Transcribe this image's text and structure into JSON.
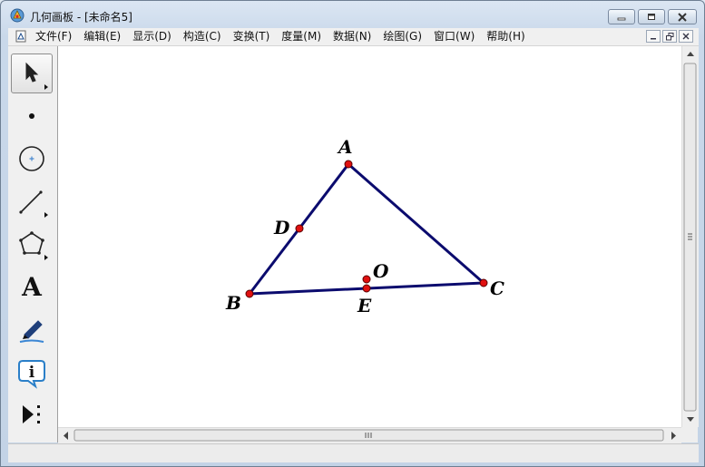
{
  "window": {
    "title": "几何画板 - [未命名5]"
  },
  "menu": {
    "items": [
      "文件(F)",
      "编辑(E)",
      "显示(D)",
      "构造(C)",
      "变换(T)",
      "度量(M)",
      "数据(N)",
      "绘图(G)",
      "窗口(W)",
      "帮助(H)"
    ]
  },
  "toolbox": {
    "tools": [
      {
        "name": "arrow-tool",
        "icon": "arrow-select-icon",
        "selected": true
      },
      {
        "name": "point-tool",
        "icon": "point-icon"
      },
      {
        "name": "compass-tool",
        "icon": "circle-icon"
      },
      {
        "name": "straightedge-tool",
        "icon": "segment-icon"
      },
      {
        "name": "polygon-tool",
        "icon": "polygon-icon"
      },
      {
        "name": "text-tool",
        "icon": "text-a-icon",
        "glyph": "A"
      },
      {
        "name": "marker-tool",
        "icon": "marker-pen-icon"
      },
      {
        "name": "information-tool",
        "icon": "info-icon",
        "glyph": "i"
      },
      {
        "name": "custom-tool",
        "icon": "custom-tools-icon"
      }
    ]
  },
  "figure": {
    "labels": {
      "A": "A",
      "B": "B",
      "C": "C",
      "D": "D",
      "E": "E",
      "O": "O"
    },
    "stroke_color": "#0b0b6e",
    "point_color": "#e01010"
  },
  "colors": {
    "canvas_bg": "#ffffff",
    "chrome_bg": "#c9d8ea"
  }
}
